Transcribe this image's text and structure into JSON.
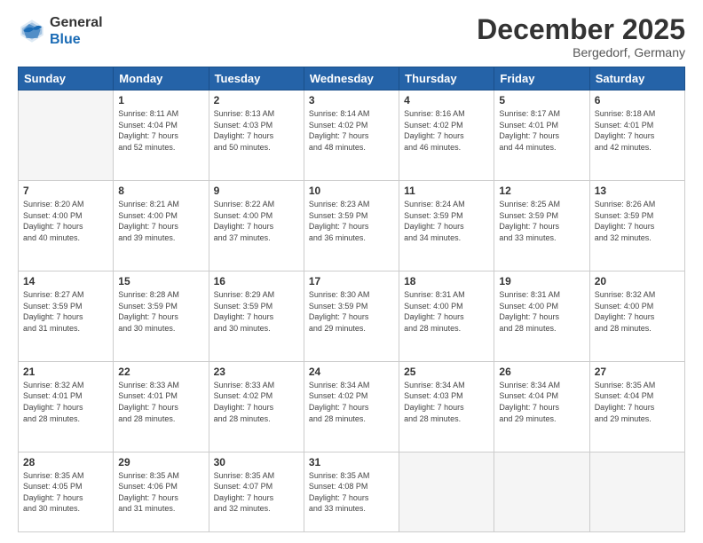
{
  "header": {
    "logo_line1": "General",
    "logo_line2": "Blue",
    "month": "December 2025",
    "location": "Bergedorf, Germany"
  },
  "weekdays": [
    "Sunday",
    "Monday",
    "Tuesday",
    "Wednesday",
    "Thursday",
    "Friday",
    "Saturday"
  ],
  "weeks": [
    [
      {
        "day": "",
        "info": ""
      },
      {
        "day": "1",
        "info": "Sunrise: 8:11 AM\nSunset: 4:04 PM\nDaylight: 7 hours\nand 52 minutes."
      },
      {
        "day": "2",
        "info": "Sunrise: 8:13 AM\nSunset: 4:03 PM\nDaylight: 7 hours\nand 50 minutes."
      },
      {
        "day": "3",
        "info": "Sunrise: 8:14 AM\nSunset: 4:02 PM\nDaylight: 7 hours\nand 48 minutes."
      },
      {
        "day": "4",
        "info": "Sunrise: 8:16 AM\nSunset: 4:02 PM\nDaylight: 7 hours\nand 46 minutes."
      },
      {
        "day": "5",
        "info": "Sunrise: 8:17 AM\nSunset: 4:01 PM\nDaylight: 7 hours\nand 44 minutes."
      },
      {
        "day": "6",
        "info": "Sunrise: 8:18 AM\nSunset: 4:01 PM\nDaylight: 7 hours\nand 42 minutes."
      }
    ],
    [
      {
        "day": "7",
        "info": "Sunrise: 8:20 AM\nSunset: 4:00 PM\nDaylight: 7 hours\nand 40 minutes."
      },
      {
        "day": "8",
        "info": "Sunrise: 8:21 AM\nSunset: 4:00 PM\nDaylight: 7 hours\nand 39 minutes."
      },
      {
        "day": "9",
        "info": "Sunrise: 8:22 AM\nSunset: 4:00 PM\nDaylight: 7 hours\nand 37 minutes."
      },
      {
        "day": "10",
        "info": "Sunrise: 8:23 AM\nSunset: 3:59 PM\nDaylight: 7 hours\nand 36 minutes."
      },
      {
        "day": "11",
        "info": "Sunrise: 8:24 AM\nSunset: 3:59 PM\nDaylight: 7 hours\nand 34 minutes."
      },
      {
        "day": "12",
        "info": "Sunrise: 8:25 AM\nSunset: 3:59 PM\nDaylight: 7 hours\nand 33 minutes."
      },
      {
        "day": "13",
        "info": "Sunrise: 8:26 AM\nSunset: 3:59 PM\nDaylight: 7 hours\nand 32 minutes."
      }
    ],
    [
      {
        "day": "14",
        "info": "Sunrise: 8:27 AM\nSunset: 3:59 PM\nDaylight: 7 hours\nand 31 minutes."
      },
      {
        "day": "15",
        "info": "Sunrise: 8:28 AM\nSunset: 3:59 PM\nDaylight: 7 hours\nand 30 minutes."
      },
      {
        "day": "16",
        "info": "Sunrise: 8:29 AM\nSunset: 3:59 PM\nDaylight: 7 hours\nand 30 minutes."
      },
      {
        "day": "17",
        "info": "Sunrise: 8:30 AM\nSunset: 3:59 PM\nDaylight: 7 hours\nand 29 minutes."
      },
      {
        "day": "18",
        "info": "Sunrise: 8:31 AM\nSunset: 4:00 PM\nDaylight: 7 hours\nand 28 minutes."
      },
      {
        "day": "19",
        "info": "Sunrise: 8:31 AM\nSunset: 4:00 PM\nDaylight: 7 hours\nand 28 minutes."
      },
      {
        "day": "20",
        "info": "Sunrise: 8:32 AM\nSunset: 4:00 PM\nDaylight: 7 hours\nand 28 minutes."
      }
    ],
    [
      {
        "day": "21",
        "info": "Sunrise: 8:32 AM\nSunset: 4:01 PM\nDaylight: 7 hours\nand 28 minutes."
      },
      {
        "day": "22",
        "info": "Sunrise: 8:33 AM\nSunset: 4:01 PM\nDaylight: 7 hours\nand 28 minutes."
      },
      {
        "day": "23",
        "info": "Sunrise: 8:33 AM\nSunset: 4:02 PM\nDaylight: 7 hours\nand 28 minutes."
      },
      {
        "day": "24",
        "info": "Sunrise: 8:34 AM\nSunset: 4:02 PM\nDaylight: 7 hours\nand 28 minutes."
      },
      {
        "day": "25",
        "info": "Sunrise: 8:34 AM\nSunset: 4:03 PM\nDaylight: 7 hours\nand 28 minutes."
      },
      {
        "day": "26",
        "info": "Sunrise: 8:34 AM\nSunset: 4:04 PM\nDaylight: 7 hours\nand 29 minutes."
      },
      {
        "day": "27",
        "info": "Sunrise: 8:35 AM\nSunset: 4:04 PM\nDaylight: 7 hours\nand 29 minutes."
      }
    ],
    [
      {
        "day": "28",
        "info": "Sunrise: 8:35 AM\nSunset: 4:05 PM\nDaylight: 7 hours\nand 30 minutes."
      },
      {
        "day": "29",
        "info": "Sunrise: 8:35 AM\nSunset: 4:06 PM\nDaylight: 7 hours\nand 31 minutes."
      },
      {
        "day": "30",
        "info": "Sunrise: 8:35 AM\nSunset: 4:07 PM\nDaylight: 7 hours\nand 32 minutes."
      },
      {
        "day": "31",
        "info": "Sunrise: 8:35 AM\nSunset: 4:08 PM\nDaylight: 7 hours\nand 33 minutes."
      },
      {
        "day": "",
        "info": ""
      },
      {
        "day": "",
        "info": ""
      },
      {
        "day": "",
        "info": ""
      }
    ]
  ]
}
